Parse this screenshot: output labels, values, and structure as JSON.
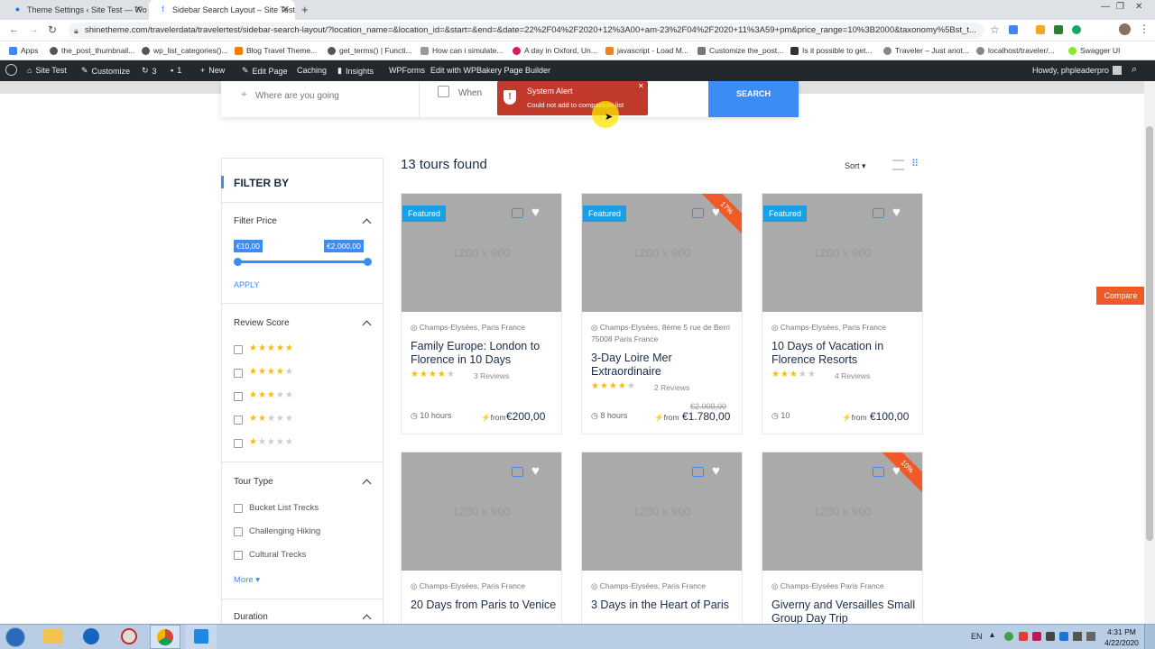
{
  "browser": {
    "tabs": [
      {
        "title": "Theme Settings ‹ Site Test — Wo",
        "active": false
      },
      {
        "title": "Sidebar Search Layout – Site Test",
        "active": true
      }
    ],
    "url": "shinetheme.com/travelerdata/travelertest/sidebar-search-layout/?location_name=&location_id=&start=&end=&date=22%2F04%2F2020+12%3A00+am-23%2F04%2F2020+11%3A59+pm&price_range=10%3B2000&taxonomy%5Bst_t...",
    "bookmarks": [
      "Apps",
      "the_post_thumbnail...",
      "wp_list_categories()...",
      "Blog Travel Theme...",
      "get_terms() | Functi...",
      "How can i simulate...",
      "A day in Oxford, Un...",
      "javascript - Load M...",
      "Customize the_post...",
      "Is it possible to get...",
      "Traveler – Just anot...",
      "localhost/traveler/...",
      "Swagger UI"
    ]
  },
  "wpbar": {
    "site": "Site Test",
    "customize": "Customize",
    "updates": "3",
    "comments": "1",
    "new": "New",
    "edit_page": "Edit Page",
    "caching": "Caching",
    "insights": "Insights",
    "wpforms": "WPForms",
    "wpbakery": "Edit with WPBakery Page Builder",
    "howdy": "Howdy, phpleaderpro"
  },
  "search": {
    "where_placeholder": "Where are you going",
    "when_label": "When",
    "button": "SEARCH"
  },
  "alert": {
    "title": "System Alert",
    "message": "Could not add to comparison list"
  },
  "results": {
    "count_text": "13 tours found",
    "sort_label": "Sort"
  },
  "compare_button": "Compare",
  "sidebar": {
    "heading": "FILTER BY",
    "price": {
      "title": "Filter Price",
      "min": "€10,00",
      "max": "€2,000,00",
      "apply": "APPLY"
    },
    "review": {
      "title": "Review Score",
      "options": [
        5,
        4,
        3,
        2,
        1
      ]
    },
    "tour_type": {
      "title": "Tour Type",
      "options": [
        "Bucket List Trecks",
        "Challenging Hiking",
        "Cultural Trecks"
      ],
      "more": "More"
    },
    "duration": {
      "title": "Duration"
    }
  },
  "cards": [
    {
      "featured": "Featured",
      "ribbon": "",
      "image": "1200 x 900",
      "location": "Champs-Elysées, Paris France",
      "title": "Family Europe: London to Florence in 10 Days",
      "stars": 4.5,
      "reviews": "3 Reviews",
      "duration": "10 hours",
      "from": "from",
      "price": "€200,00",
      "old_price": ""
    },
    {
      "featured": "Featured",
      "ribbon": "17%",
      "image": "1200 x 900",
      "location": "Champs-Elysées, 8ème 5 rue de Berri 75008 Paris France",
      "title": "3-Day Loire Mer Extraordinaire",
      "stars": 3.5,
      "reviews": "2 Reviews",
      "duration": "8 hours",
      "from": "from",
      "price": "€1.780,00",
      "old_price": "€2.000,00"
    },
    {
      "featured": "Featured",
      "ribbon": "",
      "image": "1200 x 900",
      "location": "Champs-Elysées, Paris France",
      "title": "10 Days of Vacation in Florence Resorts",
      "stars": 3,
      "reviews": "4 Reviews",
      "duration": "10",
      "from": "from",
      "price": "€100,00",
      "old_price": ""
    },
    {
      "featured": "",
      "ribbon": "",
      "image": "1200 x 900",
      "location": "Champs-Elysées, Paris France",
      "title": "20 Days from Paris to Venice"
    },
    {
      "featured": "",
      "ribbon": "",
      "image": "1200 x 900",
      "location": "Champs-Elysées, Paris France",
      "title": "3 Days in the Heart of Paris"
    },
    {
      "featured": "",
      "ribbon": "10%",
      "image": "1200 x 900",
      "location": "Champs-Elysées Paris France",
      "title": "Giverny and Versailles Small Group Day Trip"
    }
  ],
  "taskbar": {
    "lang": "EN",
    "time": "4:31 PM",
    "date": "4/22/2020"
  }
}
